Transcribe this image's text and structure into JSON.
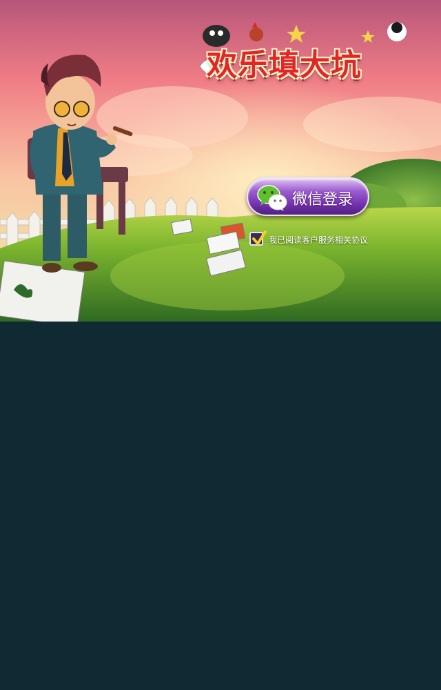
{
  "game": {
    "title": "欢乐填大坑"
  },
  "login": {
    "wechat_button_label": "微信登录",
    "agreement_text": "我已阅读客户服务相关协议",
    "agreement_checked": true
  },
  "icons": {
    "wechat": "wechat-icon",
    "checkmark": "checkmark-icon"
  },
  "colors": {
    "button_purple": "#7a3bb5",
    "title_red": "#e0262a",
    "background_dark": "#102a33",
    "checkmark_yellow": "#f4d21c"
  }
}
